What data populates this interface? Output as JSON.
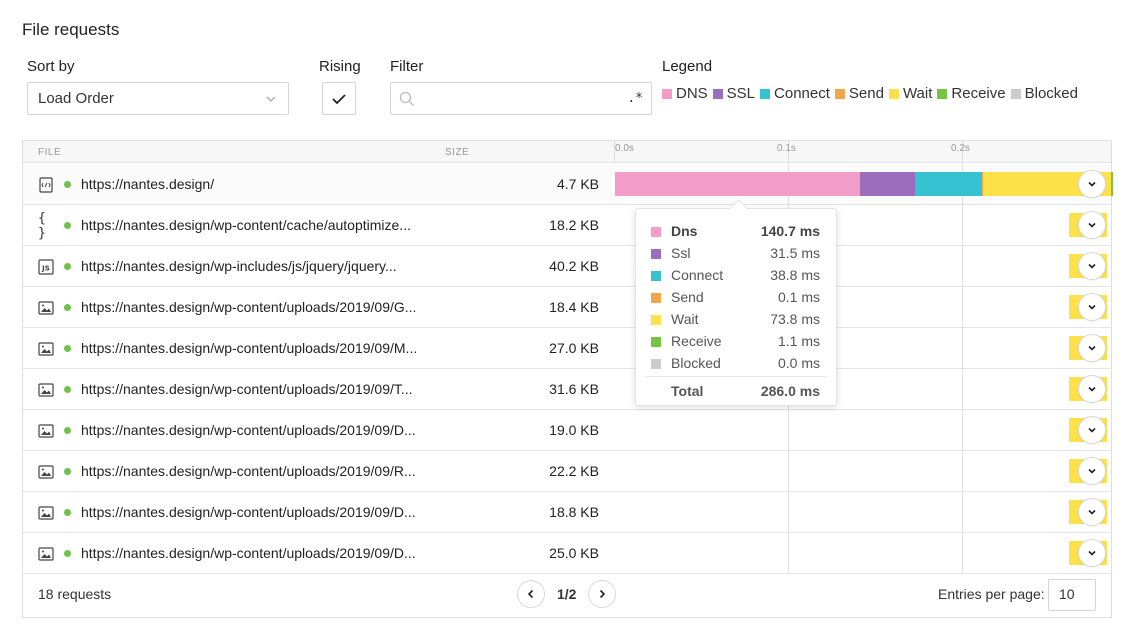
{
  "title": "File requests",
  "controls": {
    "sort_label": "Sort by",
    "sort_value": "Load Order",
    "rising_label": "Rising",
    "rising_checked": true,
    "filter_label": "Filter",
    "filter_placeholder": "",
    "filter_regex": ".*",
    "legend_label": "Legend"
  },
  "legend": [
    {
      "label": "DNS",
      "color": "#f49cc8"
    },
    {
      "label": "SSL",
      "color": "#9b6dbd"
    },
    {
      "label": "Connect",
      "color": "#35c3d2"
    },
    {
      "label": "Send",
      "color": "#f2a54a"
    },
    {
      "label": "Wait",
      "color": "#fce14b"
    },
    {
      "label": "Receive",
      "color": "#76c442"
    },
    {
      "label": "Blocked",
      "color": "#cccccc"
    }
  ],
  "table": {
    "col_file": "FILE",
    "col_size": "SIZE",
    "ticks": [
      "0.0s",
      "0.1s",
      "0.2s"
    ],
    "rows": [
      {
        "icon": "html-file-icon",
        "url": "https://nantes.design/",
        "size": "4.7 KB",
        "expanded": true
      },
      {
        "icon": "css-file-icon",
        "url": "https://nantes.design/wp-content/cache/autoptimize...",
        "size": "18.2 KB"
      },
      {
        "icon": "js-file-icon",
        "url": "https://nantes.design/wp-includes/js/jquery/jquery...",
        "size": "40.2 KB"
      },
      {
        "icon": "image-file-icon",
        "url": "https://nantes.design/wp-content/uploads/2019/09/G...",
        "size": "18.4 KB"
      },
      {
        "icon": "image-file-icon",
        "url": "https://nantes.design/wp-content/uploads/2019/09/M...",
        "size": "27.0 KB"
      },
      {
        "icon": "image-file-icon",
        "url": "https://nantes.design/wp-content/uploads/2019/09/T...",
        "size": "31.6 KB"
      },
      {
        "icon": "image-file-icon",
        "url": "https://nantes.design/wp-content/uploads/2019/09/D...",
        "size": "19.0 KB"
      },
      {
        "icon": "image-file-icon",
        "url": "https://nantes.design/wp-content/uploads/2019/09/R...",
        "size": "22.2 KB"
      },
      {
        "icon": "image-file-icon",
        "url": "https://nantes.design/wp-content/uploads/2019/09/D...",
        "size": "18.8 KB"
      },
      {
        "icon": "image-file-icon",
        "url": "https://nantes.design/wp-content/uploads/2019/09/D...",
        "size": "25.0 KB"
      }
    ]
  },
  "tooltip": {
    "rows": [
      {
        "label": "Dns",
        "value": "140.7 ms",
        "color": "#f49cc8"
      },
      {
        "label": "Ssl",
        "value": "31.5 ms",
        "color": "#9b6dbd"
      },
      {
        "label": "Connect",
        "value": "38.8 ms",
        "color": "#35c3d2"
      },
      {
        "label": "Send",
        "value": "0.1 ms",
        "color": "#f2a54a"
      },
      {
        "label": "Wait",
        "value": "73.8 ms",
        "color": "#fce14b"
      },
      {
        "label": "Receive",
        "value": "1.1 ms",
        "color": "#76c442"
      },
      {
        "label": "Blocked",
        "value": "0.0 ms",
        "color": "#cccccc"
      }
    ],
    "total_label": "Total",
    "total_value": "286.0 ms"
  },
  "footer": {
    "requests": "18 requests",
    "page": "1/2",
    "entries_label": "Entries per page:",
    "entries_value": "10"
  }
}
